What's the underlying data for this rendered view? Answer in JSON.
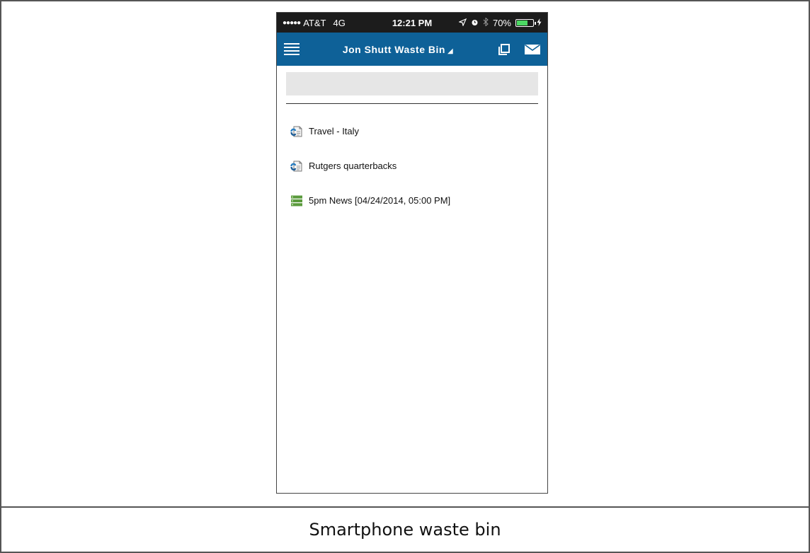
{
  "status_bar": {
    "signal_dots": "●●●●●",
    "carrier": "AT&T",
    "network": "4G",
    "time": "12:21 PM",
    "battery_percent": "70%",
    "battery_level": 0.7,
    "icons": [
      "location-arrow-icon",
      "alarm-icon",
      "bluetooth-icon",
      "battery-icon",
      "charging-bolt-icon"
    ]
  },
  "nav": {
    "title": "Jon Shutt Waste Bin",
    "title_indicator": "◢",
    "icons": [
      "hamburger-menu-icon",
      "copy-icon",
      "mail-icon"
    ]
  },
  "search": {
    "placeholder": ""
  },
  "items": [
    {
      "label": "Travel - Italy",
      "icon": "document-link-icon"
    },
    {
      "label": "Rutgers quarterbacks",
      "icon": "document-link-icon"
    },
    {
      "label": "5pm News [04/24/2014, 05:00 PM]",
      "icon": "rundown-stack-icon"
    }
  ],
  "caption": "Smartphone waste bin",
  "colors": {
    "navbar": "#0e6198",
    "statusbar": "#1c1c1c",
    "battery_fill": "#4cd964",
    "search_bg": "#e6e6e6",
    "rundown_icon": "#5a9a3c"
  }
}
